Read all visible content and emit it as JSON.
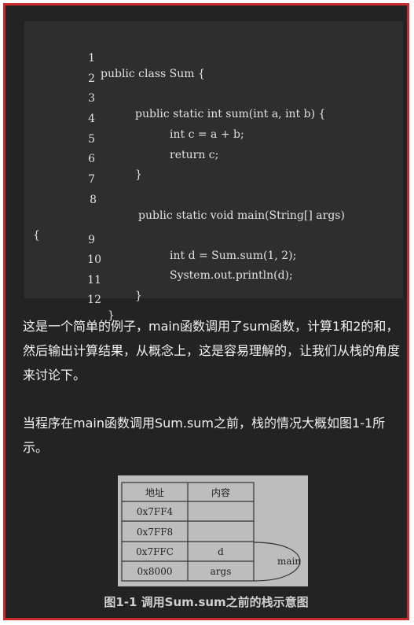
{
  "code": {
    "lines": [
      {
        "num": "1",
        "text": "public class Sum {"
      },
      {
        "num": "2",
        "text": ""
      },
      {
        "num": "3",
        "text": "public static int sum(int a, int b) {"
      },
      {
        "num": "4",
        "text": "int c = a + b;"
      },
      {
        "num": "5",
        "text": "return c;"
      },
      {
        "num": "6",
        "text": "}"
      },
      {
        "num": "7",
        "text": ""
      },
      {
        "num": "8",
        "text": "public static void main(String[] args)"
      },
      {
        "num": "",
        "text": "{"
      },
      {
        "num": "9",
        "text": "int d = Sum.sum(1, 2);"
      },
      {
        "num": "10",
        "text": "System.out.println(d);"
      },
      {
        "num": "11",
        "text": "}"
      },
      {
        "num": "12",
        "text": "}"
      }
    ]
  },
  "paragraphs": {
    "p1": "这是一个简单的例子，main函数调用了sum函数，计算1和2的和，然后输出计算结果，从概念上，这是容易理解的，让我们从栈的角度来讨论下。",
    "p2": "当程序在main函数调用Sum.sum之前，栈的情况大概如图1-1所示。"
  },
  "figure": {
    "header_address": "地址",
    "header_content": "内容",
    "rows": [
      {
        "address": "0x7FF4",
        "content": ""
      },
      {
        "address": "0x7FF8",
        "content": ""
      },
      {
        "address": "0x7FFC",
        "content": "d"
      },
      {
        "address": "0x8000",
        "content": "args"
      }
    ],
    "brace_label": "main",
    "caption": "图1-1 调用Sum.sum之前的栈示意图"
  }
}
